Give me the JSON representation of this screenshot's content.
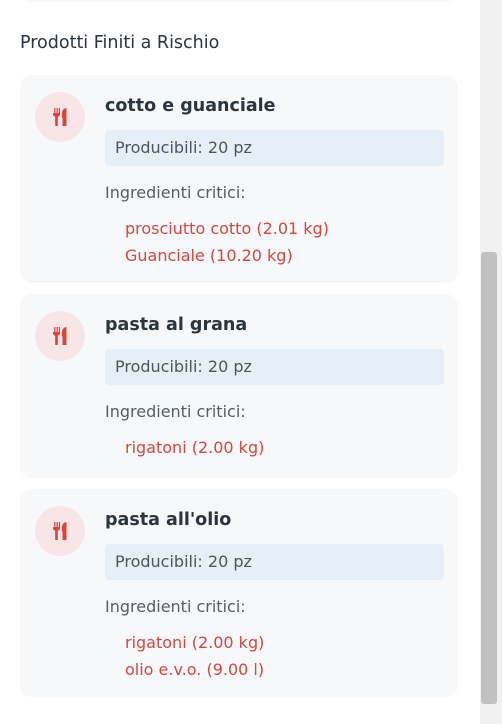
{
  "section_title": "Prodotti Finiti a Rischio",
  "icon_name": "utensils-icon",
  "accent_color": "#d9453c",
  "products": [
    {
      "name": "cotto e guanciale",
      "producible": "Producibili: 20 pz",
      "critical_label": "Ingredienti critici:",
      "ingredients": [
        "prosciutto cotto (2.01 kg)",
        "Guanciale (10.20 kg)"
      ]
    },
    {
      "name": "pasta al grana",
      "producible": "Producibili: 20 pz",
      "critical_label": "Ingredienti critici:",
      "ingredients": [
        "rigatoni (2.00 kg)"
      ]
    },
    {
      "name": "pasta all'olio",
      "producible": "Producibili: 20 pz",
      "critical_label": "Ingredienti critici:",
      "ingredients": [
        "rigatoni (2.00 kg)",
        "olio e.v.o. (9.00 l)"
      ]
    }
  ]
}
